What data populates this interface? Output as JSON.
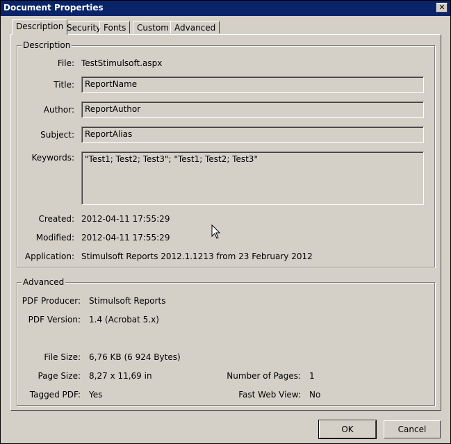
{
  "window": {
    "title": "Document Properties",
    "close": "✕"
  },
  "tabs": [
    "Description",
    "Security",
    "Fonts",
    "Custom",
    "Advanced"
  ],
  "description": {
    "group_label": "Description",
    "file_label": "File:",
    "file_value": "TestStimulsoft.aspx",
    "title_label": "Title:",
    "title_value": "ReportName",
    "author_label": "Author:",
    "author_value": "ReportAuthor",
    "subject_label": "Subject:",
    "subject_value": "ReportAlias",
    "keywords_label": "Keywords:",
    "keywords_value": "\"Test1; Test2; Test3\"; \"Test1; Test2; Test3\"",
    "created_label": "Created:",
    "created_value": "2012-04-11 17:55:29",
    "modified_label": "Modified:",
    "modified_value": "2012-04-11 17:55:29",
    "application_label": "Application:",
    "application_value": "Stimulsoft Reports 2012.1.1213 from 23 February 2012"
  },
  "advanced": {
    "group_label": "Advanced",
    "producer_label": "PDF Producer:",
    "producer_value": "Stimulsoft Reports",
    "version_label": "PDF Version:",
    "version_value": "1.4 (Acrobat 5.x)",
    "filesize_label": "File Size:",
    "filesize_value": "6,76 KB (6 924 Bytes)",
    "pagesize_label": "Page Size:",
    "pagesize_value": "8,27 x 11,69 in",
    "pages_label": "Number of Pages:",
    "pages_value": "1",
    "tagged_label": "Tagged PDF:",
    "tagged_value": "Yes",
    "fastweb_label": "Fast Web View:",
    "fastweb_value": "No"
  },
  "buttons": {
    "ok": "OK",
    "cancel": "Cancel"
  }
}
